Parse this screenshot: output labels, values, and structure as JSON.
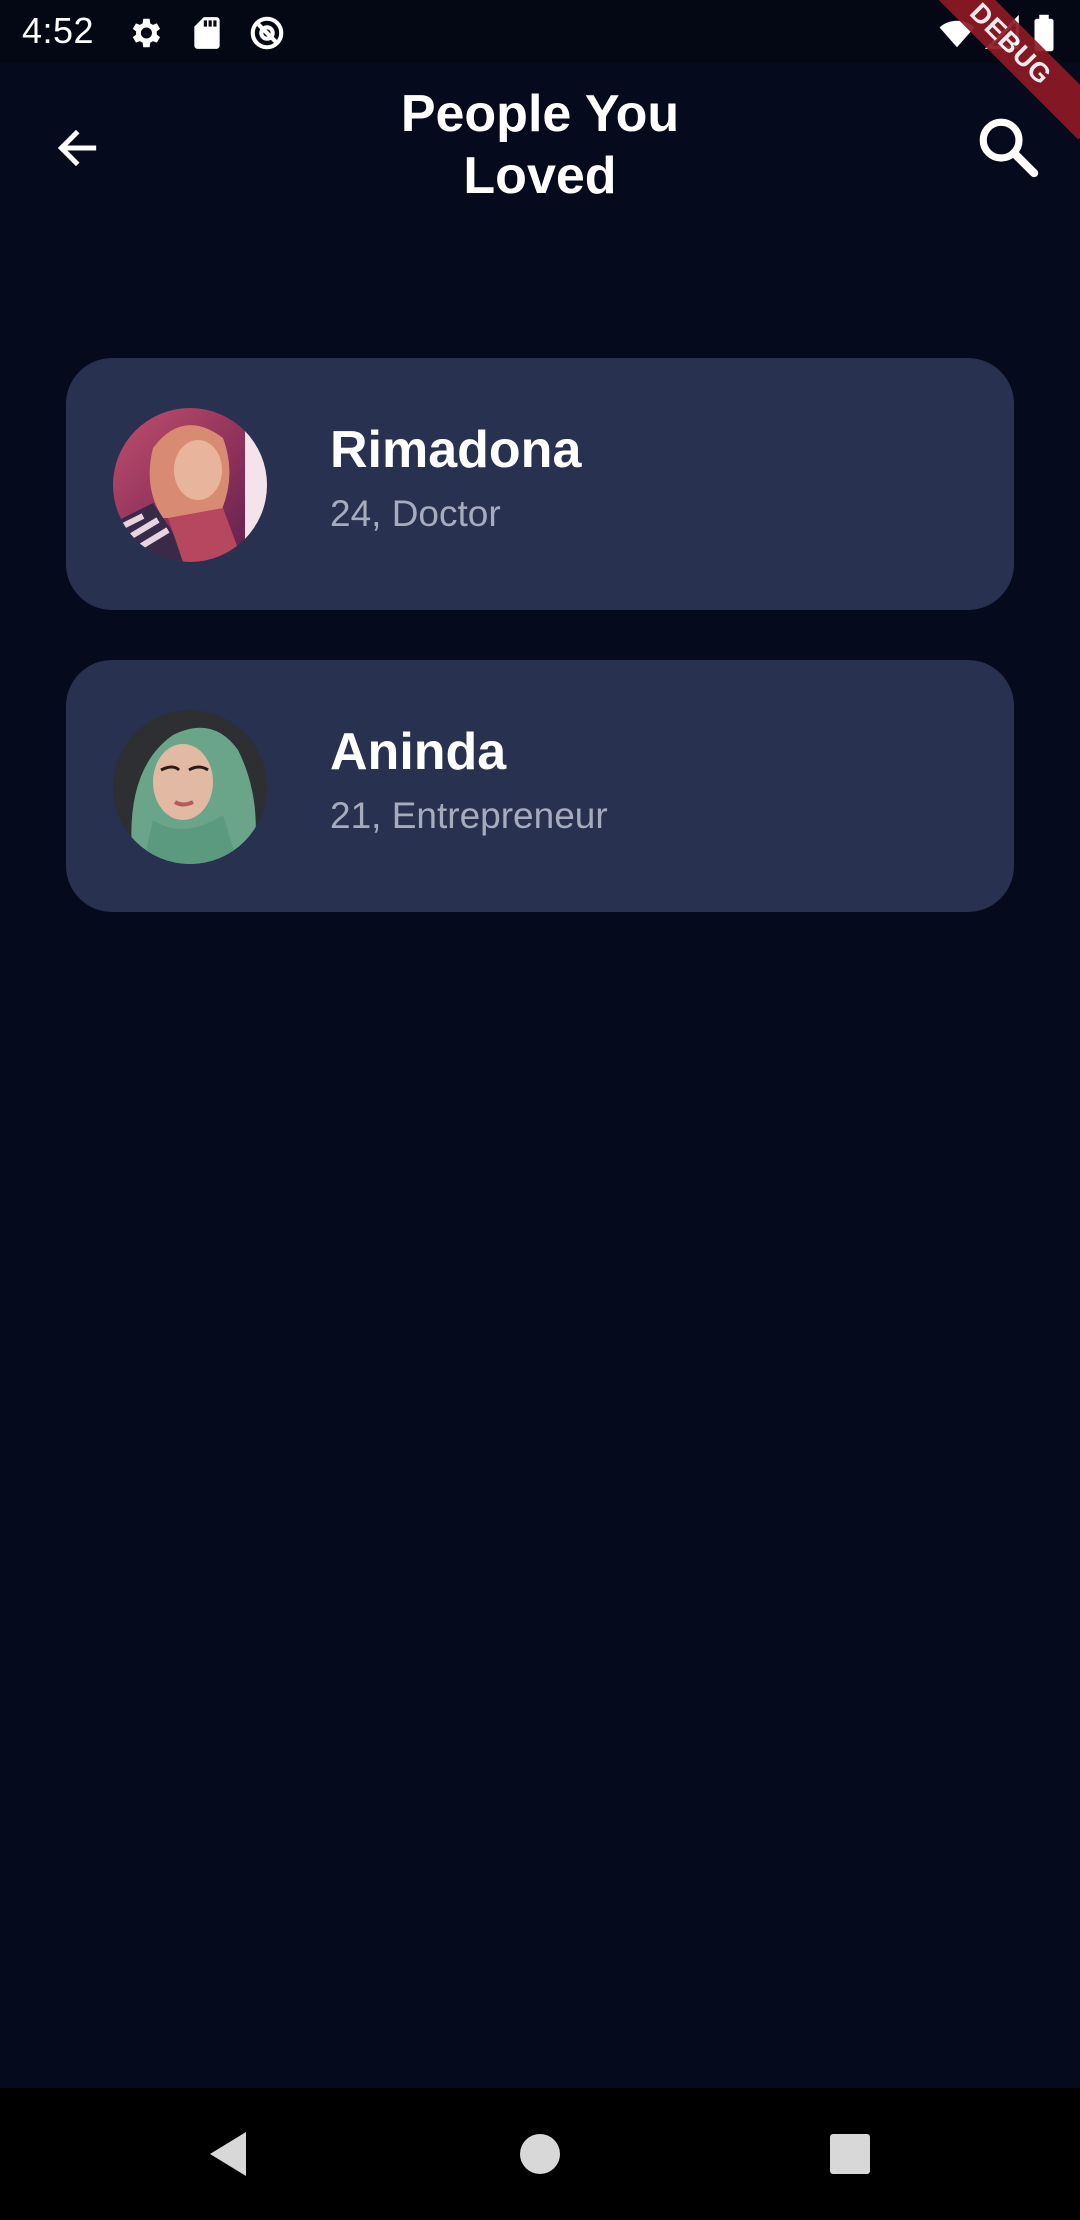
{
  "status_bar": {
    "time": "4:52",
    "left_icons": [
      "gear-icon",
      "sd-card-icon",
      "at-sign-icon"
    ],
    "right_icons": [
      "wifi-icon",
      "signal-icon",
      "battery-icon"
    ]
  },
  "debug_banner": {
    "label": "DEBUG",
    "color": "#8e1a25"
  },
  "app_bar": {
    "title": "People You Loved",
    "back_icon": "arrow-back-icon",
    "search_icon": "search-icon"
  },
  "people": [
    {
      "name": "Rimadona",
      "info": "24, Doctor",
      "avatar": "avatar-photo-rimadona"
    },
    {
      "name": "Aninda",
      "info": "21, Entrepreneur",
      "avatar": "avatar-photo-aninda"
    }
  ],
  "nav_bar": {
    "icons": [
      "nav-back-icon",
      "nav-home-icon",
      "nav-recents-icon"
    ]
  },
  "colors": {
    "background": "#050a1c",
    "card": "#283150",
    "subtitle": "#a6abbd",
    "nav_bar": "#000000"
  }
}
